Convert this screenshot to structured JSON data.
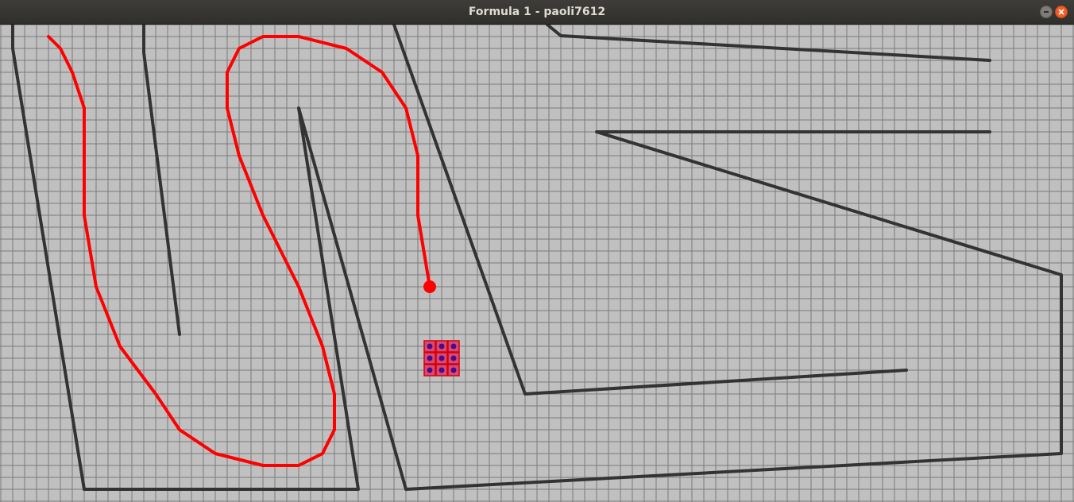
{
  "window": {
    "title": "Formula 1 - paoli7612",
    "minimize_icon": "minimize-icon",
    "close_icon": "close-icon"
  },
  "game": {
    "colors": {
      "background": "#c0c0c0",
      "grid": "#7a7a7a",
      "wall": "#333333",
      "trail": "#ff0000",
      "candidate_cell": "#d64a7a",
      "candidate_cell_border": "#d60000",
      "candidate_dot": "#4a0a8a"
    },
    "car": {
      "name": "player-car",
      "icon": "car-dot"
    },
    "next_moves": {
      "rows": 3,
      "cols": 3
    }
  }
}
